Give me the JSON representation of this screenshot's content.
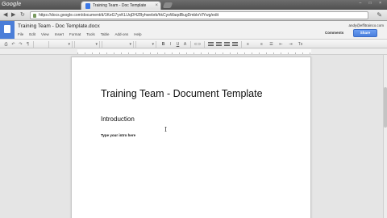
{
  "browser": {
    "logo_text": "Google",
    "tab_title": "Training Team - Doc Template",
    "tab_close": "×",
    "window_buttons": "– □ ×",
    "back_label": "◀",
    "forward_label": "▶",
    "reload_label": "↻",
    "url": "https://docs.google.com/document/d/1KeG7yvKLUqDHZByhwebrb/hkCyoWaqdBugDmbkrVlYwg/edit",
    "wrench_label": "✎"
  },
  "docs": {
    "title": "Training Team - Doc Template.docx",
    "menu": [
      "File",
      "Edit",
      "View",
      "Insert",
      "Format",
      "Tools",
      "Table",
      "Add-ons",
      "Help"
    ],
    "user_email": "andy@effitrainco.com",
    "comments_label": "Comments",
    "share_label": "Share"
  },
  "toolbar": {
    "print": "⎙",
    "undo": "↶",
    "redo": "↷",
    "paint": "¶",
    "bold": "B",
    "italic": "I",
    "underline": "U",
    "text_color": "A",
    "link": "⊂⊃",
    "list_numbered": "≡",
    "list_bullet": "☰",
    "indent_less": "⇤",
    "indent_more": "⇥",
    "clear": "Tx"
  },
  "document": {
    "heading": "Training Team - Document Template",
    "subheading": "Introduction",
    "body": "Type your intro here",
    "cursor": "I"
  },
  "colors": {
    "share_blue": "#4a7fdc",
    "docs_blue": "#4b7ed8"
  }
}
